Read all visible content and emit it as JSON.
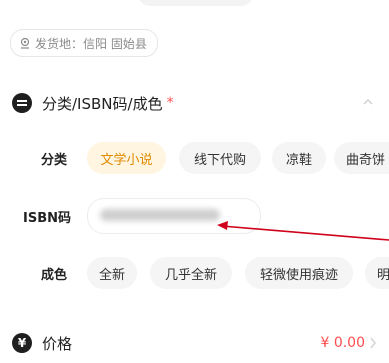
{
  "shipping": {
    "label": "发货地：信阳 固始县"
  },
  "section": {
    "title": "分类/ISBN码/成色",
    "required_mark": "*"
  },
  "category": {
    "label": "分类",
    "options": [
      "文学小说",
      "线下代购",
      "凉鞋",
      "曲奇饼"
    ],
    "selected": "文学小说"
  },
  "isbn": {
    "label": "ISBN码",
    "value": ""
  },
  "condition": {
    "label": "成色",
    "options": [
      "全新",
      "几乎全新",
      "轻微使用痕迹",
      "明"
    ]
  },
  "price": {
    "label": "价格",
    "value": "¥ 0.00"
  },
  "colors": {
    "accent": "#e08a00",
    "accent_bg": "#fff5e0",
    "price": "#ff4d4f",
    "arrow": "#d0021b"
  },
  "icons": {
    "location": "location-pin-icon",
    "section": "category-icon",
    "price": "yen-icon",
    "collapse": "chevron-up-icon",
    "more": "chevron-right-icon"
  }
}
